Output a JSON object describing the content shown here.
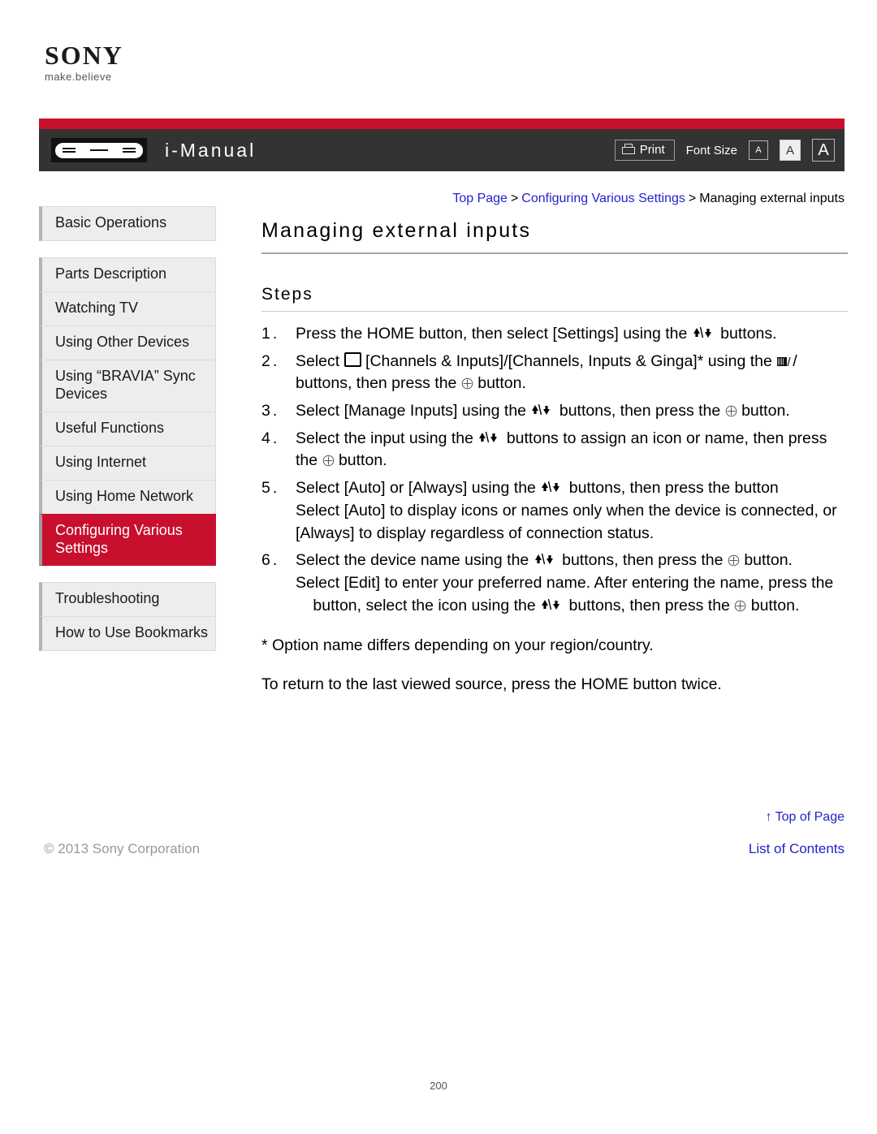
{
  "brand": {
    "logo_text": "SONY",
    "tagline": "make.believe"
  },
  "header": {
    "title": "i-Manual",
    "remote_icon": "remote-control-icon",
    "print_label": "Print",
    "print_icon": "printer-icon",
    "font_size_label": "Font Size",
    "font_size_options": [
      "A",
      "A",
      "A"
    ],
    "font_size_selected_index": 1,
    "accent_red": "#c8102e",
    "bar_dark": "#333333"
  },
  "breadcrumb": {
    "items": [
      {
        "label": "Top Page",
        "link": true
      },
      {
        "label": "Configuring Various Settings",
        "link": true
      },
      {
        "label": "Managing external inputs",
        "link": false
      }
    ],
    "separator": ">"
  },
  "sidebar": {
    "groups": [
      {
        "items": [
          {
            "label": "Basic Operations",
            "active": false
          }
        ]
      },
      {
        "items": [
          {
            "label": "Parts Description",
            "active": false
          },
          {
            "label": "Watching TV",
            "active": false
          },
          {
            "label": "Using Other Devices",
            "active": false
          },
          {
            "label": "Using “BRAVIA” Sync Devices",
            "active": false
          },
          {
            "label": "Useful Functions",
            "active": false
          },
          {
            "label": "Using Internet",
            "active": false
          },
          {
            "label": "Using Home Network",
            "active": false
          },
          {
            "label": "Configuring Various Settings",
            "active": true
          }
        ]
      },
      {
        "items": [
          {
            "label": "Troubleshooting",
            "active": false
          },
          {
            "label": "How to Use Bookmarks",
            "active": false
          }
        ]
      }
    ]
  },
  "main": {
    "title": "Managing external inputs",
    "section_title": "Steps",
    "steps": [
      {
        "number": "1.",
        "parts": [
          {
            "t": "text",
            "v": "Press the HOME button, then select [Settings] using the "
          },
          {
            "t": "icon",
            "v": "up-down-buttons-icon"
          },
          {
            "t": "text",
            "v": " buttons."
          }
        ]
      },
      {
        "number": "2.",
        "parts": [
          {
            "t": "text",
            "v": "Select "
          },
          {
            "t": "icon",
            "v": "display-square-icon"
          },
          {
            "t": "text",
            "v": " [Channels & Inputs]/[Channels, Inputs & Ginga]* using the "
          },
          {
            "t": "icon",
            "v": "remote-small-icon"
          },
          {
            "t": "text",
            "v": "/"
          },
          {
            "t": "blank",
            "v": ""
          },
          {
            "t": "text",
            "v": " buttons, then press the "
          },
          {
            "t": "icon",
            "v": "circled-plus-icon"
          },
          {
            "t": "text",
            "v": " button."
          }
        ]
      },
      {
        "number": "3.",
        "parts": [
          {
            "t": "text",
            "v": "Select [Manage Inputs] using the "
          },
          {
            "t": "icon",
            "v": "up-down-buttons-icon"
          },
          {
            "t": "text",
            "v": " buttons, then press the "
          },
          {
            "t": "icon",
            "v": "circled-plus-icon"
          },
          {
            "t": "text",
            "v": " button."
          }
        ]
      },
      {
        "number": "4.",
        "parts": [
          {
            "t": "text",
            "v": "Select the input using the "
          },
          {
            "t": "icon",
            "v": "up-down-buttons-icon"
          },
          {
            "t": "text",
            "v": " buttons to assign an icon or name, then press the "
          },
          {
            "t": "icon",
            "v": "circled-plus-icon"
          },
          {
            "t": "text",
            "v": " button."
          }
        ]
      },
      {
        "number": "5.",
        "parts": [
          {
            "t": "text",
            "v": "Select [Auto] or [Always] using the "
          },
          {
            "t": "icon",
            "v": "up-down-buttons-icon"
          },
          {
            "t": "text",
            "v": " buttons, then press the button"
          },
          {
            "t": "break",
            "v": ""
          },
          {
            "t": "text",
            "v": "Select [Auto] to display icons or names only when the device is connected, or [Always] to display regardless of connection status."
          }
        ]
      },
      {
        "number": "6.",
        "parts": [
          {
            "t": "text",
            "v": "Select the device name using the "
          },
          {
            "t": "icon",
            "v": "up-down-buttons-icon"
          },
          {
            "t": "text",
            "v": " buttons, then press the "
          },
          {
            "t": "icon",
            "v": "circled-plus-icon"
          },
          {
            "t": "text",
            "v": " button."
          },
          {
            "t": "break",
            "v": ""
          },
          {
            "t": "text",
            "v": "Select [Edit] to enter your preferred name. After entering the name, press the "
          },
          {
            "t": "blank",
            "v": ""
          },
          {
            "t": "text",
            "v": " button, select the icon using the "
          },
          {
            "t": "icon",
            "v": "up-down-buttons-icon"
          },
          {
            "t": "text",
            "v": " buttons, then press the "
          },
          {
            "t": "icon",
            "v": "circled-plus-icon"
          },
          {
            "t": "text",
            "v": " button."
          }
        ]
      }
    ],
    "footnote": "* Option name differs depending on your region/country.",
    "closing_note": "To return to the last viewed source, press the HOME button twice."
  },
  "footer": {
    "top_of_page": "↑ Top of Page",
    "copyright": "© 2013 Sony Corporation",
    "list_of_contents": "List of Contents",
    "page_number": "200",
    "link_color": "#2222cc"
  }
}
